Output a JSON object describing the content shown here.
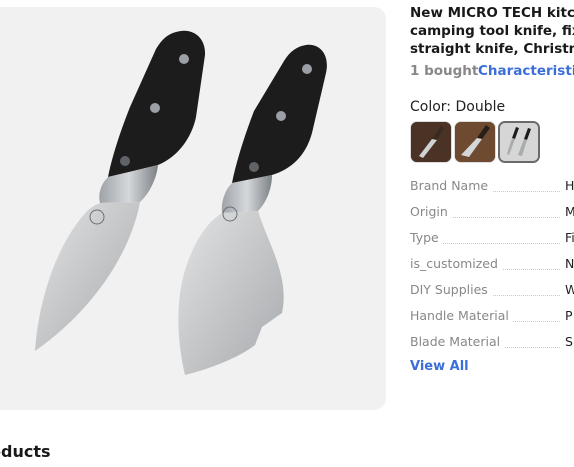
{
  "product": {
    "title_lines": [
      "New MICRO TECH kitche",
      "camping tool knife, fixed",
      "straight knife, Christmas"
    ],
    "sales": "1 bought",
    "characteristics_link": "Characteristic",
    "color_label": "Color: Double",
    "swatches": [
      "brown-handle-variant",
      "brown-handle-variant-2",
      "double-knife-variant"
    ]
  },
  "specs": [
    {
      "name": "Brand Name",
      "value": "H"
    },
    {
      "name": "Origin",
      "value": "M"
    },
    {
      "name": "Type",
      "value": "Fi"
    },
    {
      "name": "is_customized",
      "value": "N"
    },
    {
      "name": "DIY Supplies",
      "value": "W"
    },
    {
      "name": "Handle Material",
      "value": "P"
    },
    {
      "name": "Blade Material",
      "value": "Sl"
    }
  ],
  "view_all": "View All",
  "bottom_heading": "oducts",
  "colors": {
    "link": "#3b6ed8",
    "image_bg": "#f1f1f1",
    "handle": "#1c1c1c",
    "blade": "#c9cacb"
  }
}
